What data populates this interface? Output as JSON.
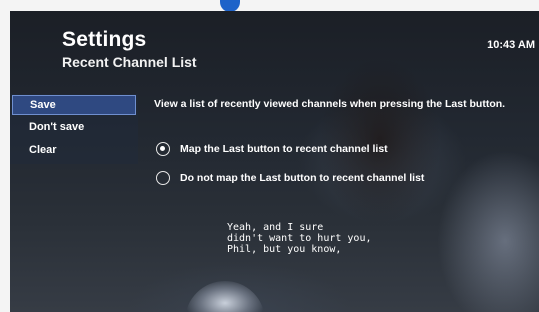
{
  "header": {
    "title": "Settings",
    "subtitle": "Recent Channel List",
    "time": "10:43 AM"
  },
  "menu": {
    "items": [
      {
        "label": "Save",
        "selected": true
      },
      {
        "label": "Don't save",
        "selected": false
      },
      {
        "label": "Clear",
        "selected": false
      }
    ]
  },
  "content": {
    "description": "View a list of recently viewed channels when pressing the Last button.",
    "options": [
      {
        "label": "Map the Last button to recent channel list",
        "checked": true
      },
      {
        "label": "Do not map the Last button to recent channel list",
        "checked": false
      }
    ]
  },
  "caption": {
    "lines": [
      "Yeah, and I sure",
      "didn't want to hurt you,",
      "Phil, but you know,"
    ]
  },
  "colors": {
    "menu_highlight": "#385aaa",
    "camera_indicator": "#1e63c9"
  }
}
